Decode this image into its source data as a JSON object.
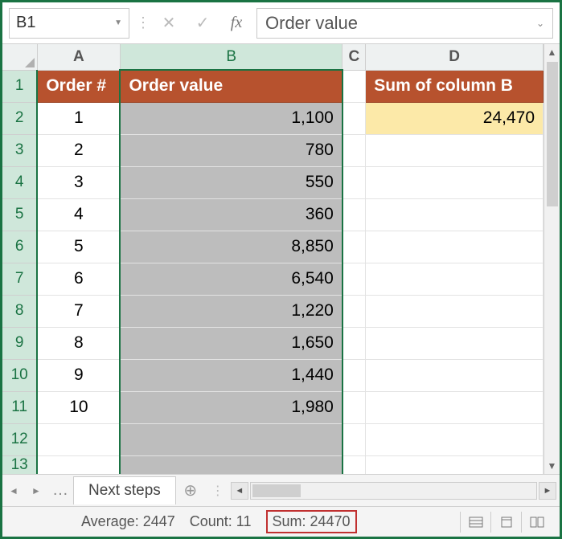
{
  "nameBox": "B1",
  "formulaInput": "Order value",
  "columns": {
    "A": "A",
    "B": "B",
    "C": "C",
    "D": "D"
  },
  "headers": {
    "A": "Order #",
    "B": "Order value",
    "D": "Sum of column B"
  },
  "sumValue": "24,470",
  "rows": [
    {
      "num": "1",
      "order": "1",
      "value": "1,100"
    },
    {
      "num": "2",
      "order": "2",
      "value": "780"
    },
    {
      "num": "3",
      "order": "3",
      "value": "550"
    },
    {
      "num": "4",
      "order": "4",
      "value": "360"
    },
    {
      "num": "5",
      "order": "5",
      "value": "8,850"
    },
    {
      "num": "6",
      "order": "6",
      "value": "6,540"
    },
    {
      "num": "7",
      "order": "7",
      "value": "1,220"
    },
    {
      "num": "8",
      "order": "8",
      "value": "1,650"
    },
    {
      "num": "9",
      "order": "9",
      "value": "1,440"
    },
    {
      "num": "10",
      "order": "10",
      "value": "1,980"
    }
  ],
  "emptyRows": [
    "12",
    "13"
  ],
  "sheetTab": "Next steps",
  "status": {
    "average": "Average: 2447",
    "count": "Count: 11",
    "sum": "Sum: 24470"
  }
}
